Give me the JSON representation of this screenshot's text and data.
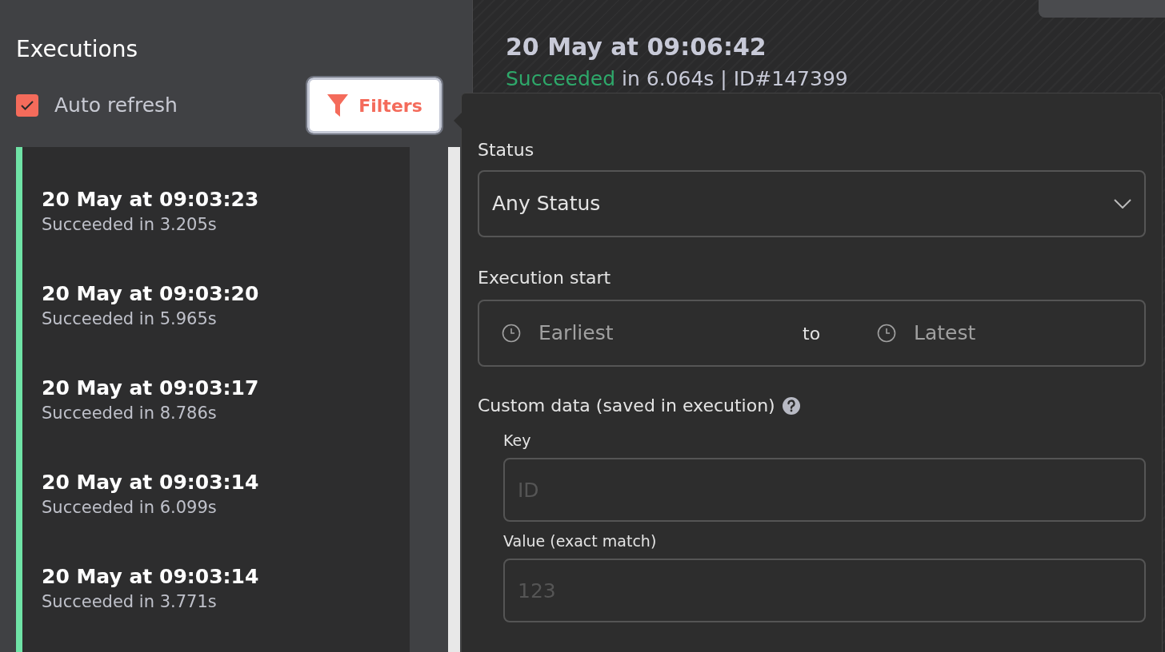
{
  "sidebar": {
    "title": "Executions",
    "auto_refresh": {
      "label": "Auto refresh",
      "checked": true
    },
    "filters_button": "Filters",
    "executions": [
      {
        "time": "20 May at 09:03:23",
        "status": "Succeeded in 3.205s"
      },
      {
        "time": "20 May at 09:03:20",
        "status": "Succeeded in 5.965s"
      },
      {
        "time": "20 May at 09:03:17",
        "status": "Succeeded in 8.786s"
      },
      {
        "time": "20 May at 09:03:14",
        "status": "Succeeded in 6.099s"
      },
      {
        "time": "20 May at 09:03:14",
        "status": "Succeeded in 3.771s"
      }
    ]
  },
  "detail": {
    "time": "20 May at 09:06:42",
    "status": "Succeeded",
    "duration": "in 6.064s | ID#147399"
  },
  "filters": {
    "status_label": "Status",
    "status_value": "Any Status",
    "start_label": "Execution start",
    "from_placeholder": "Earliest",
    "to": "to",
    "until_placeholder": "Latest",
    "custom_label": "Custom data (saved in execution)",
    "key_label": "Key",
    "key_placeholder": "ID",
    "value_label": "Value (exact match)",
    "value_placeholder": "123"
  }
}
